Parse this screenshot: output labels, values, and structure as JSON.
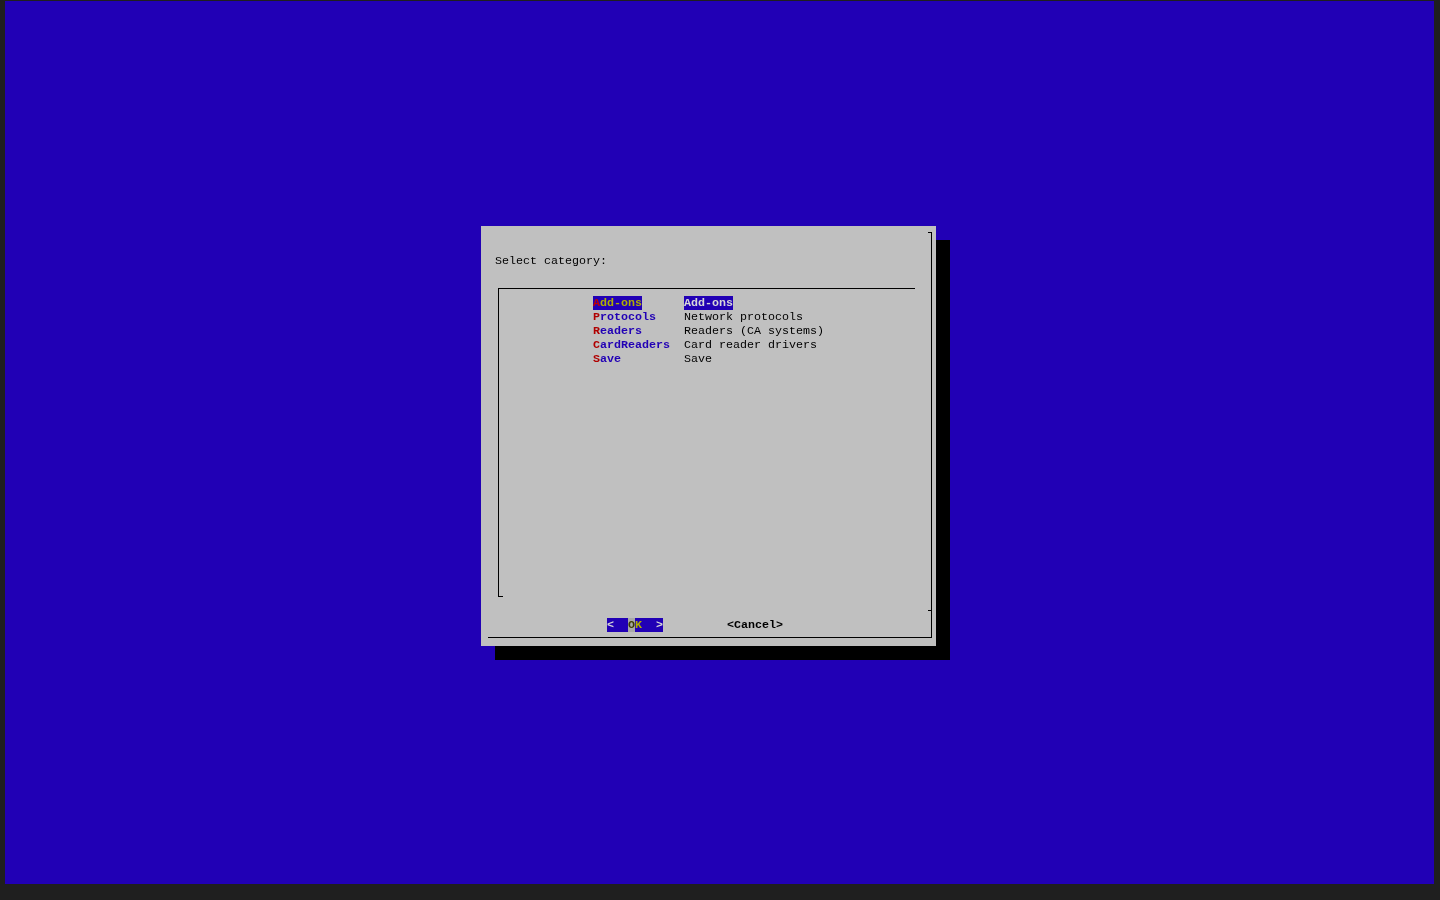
{
  "dialog": {
    "prompt": "Select category:",
    "menu": {
      "items": [
        {
          "tag": "Add-ons",
          "description": "Add-ons",
          "selected": true
        },
        {
          "tag": "Protocols",
          "description": "Network protocols",
          "selected": false
        },
        {
          "tag": "Readers",
          "description": "Readers (CA systems)",
          "selected": false
        },
        {
          "tag": "CardReaders",
          "description": "Card reader drivers",
          "selected": false
        },
        {
          "tag": "Save",
          "description": "Save",
          "selected": false
        }
      ]
    },
    "buttons": [
      {
        "label": "<  OK  >",
        "selected": true,
        "cursor": true
      },
      {
        "label": "<Cancel>",
        "selected": false,
        "cursor": false
      }
    ]
  }
}
